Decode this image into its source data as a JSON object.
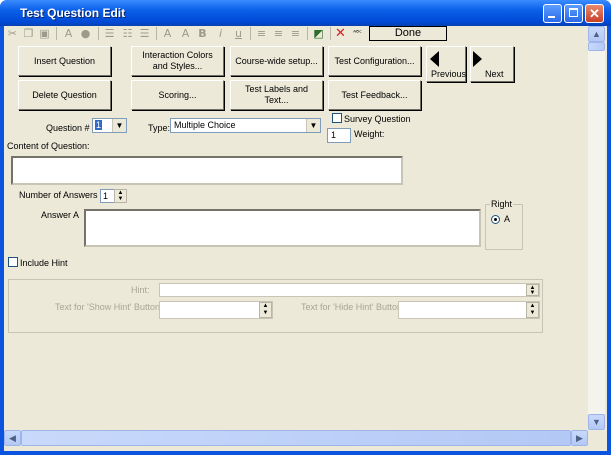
{
  "window": {
    "title": "Test Question Edit"
  },
  "toolbar": {
    "icons": [
      "cut-icon",
      "copy-icon",
      "paste-icon",
      "font-icon",
      "color-icon",
      "bullets-icon",
      "numbered-list-icon",
      "outdent-icon",
      "grow-font-icon",
      "shrink-font-icon",
      "bold-icon",
      "italic-icon",
      "underline-icon",
      "align-left-icon",
      "align-center-icon",
      "align-right-icon",
      "find-icon",
      "delete-icon",
      "spellcheck-icon"
    ],
    "done_label": "Done"
  },
  "buttons": {
    "insert_question": "Insert Question",
    "interaction_colors": "Interaction Colors and Styles...",
    "course_wide_setup": "Course-wide setup...",
    "test_configuration": "Test Configuration...",
    "delete_question": "Delete Question",
    "scoring": "Scoring...",
    "test_labels": "Test Labels and Text...",
    "test_feedback": "Test Feedback...",
    "previous": "Previous",
    "next": "Next"
  },
  "question": {
    "number_label": "Question #",
    "number_value": "1",
    "type_label": "Type:",
    "type_value": "Multiple Choice",
    "survey_label": "Survey Question",
    "weight_label": "Weight:",
    "weight_value": "1",
    "content_label": "Content of Question:",
    "content_value": ""
  },
  "answers": {
    "count_label": "Number of Answers",
    "count_value": "1",
    "answer_a_label": "Answer A",
    "answer_a_value": "",
    "right_label": "Right",
    "right_option": "A"
  },
  "hint": {
    "include_label": "Include Hint",
    "hint_label": "Hint:",
    "show_hint_label": "Text for 'Show Hint' Button",
    "hide_hint_label": "Text for 'Hide Hint' Button"
  }
}
